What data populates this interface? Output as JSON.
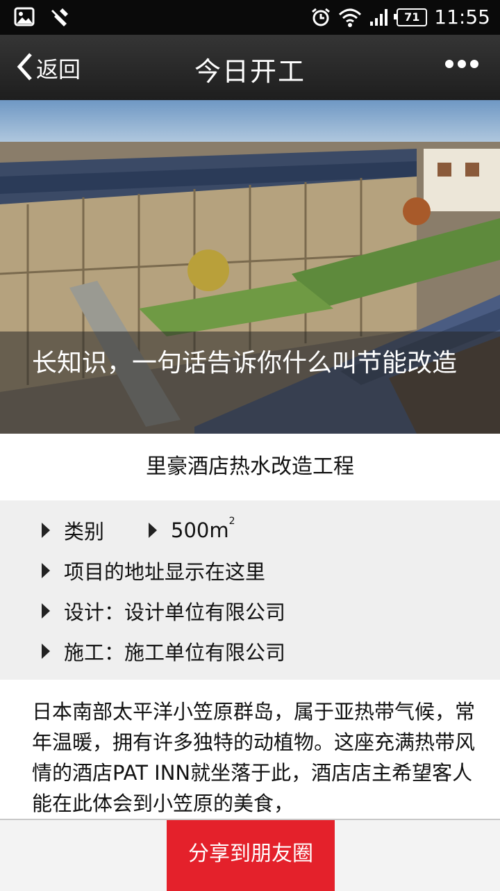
{
  "status_bar": {
    "battery": "71",
    "time": "11:55",
    "icons": [
      "image-icon",
      "wrench-icon",
      "alarm-icon",
      "wifi-icon",
      "signal-icon",
      "battery-icon"
    ]
  },
  "nav": {
    "back_label": "返回",
    "title": "今日开工",
    "more_icon": "more-dots-icon"
  },
  "hero": {
    "caption": "长知识，一句话告诉你什么叫节能改造"
  },
  "project": {
    "title": "里豪酒店热水改造工程",
    "category_label": "类别",
    "area": "500m",
    "area_superscript": "2",
    "address": "项目的地址显示在这里",
    "design": "设计：设计单位有限公司",
    "construction": "施工：施工单位有限公司"
  },
  "article": {
    "text": "日本南部太平洋小笠原群岛，属于亚热带气候，常年温暖，拥有许多独特的动植物。这座充满热带风情的酒店PAT INN就坐落于此，酒店店主希望客人能在此体会到小笠原的美食，"
  },
  "footer": {
    "share_label": "分享到朋友圈",
    "share_color": "#e4212b"
  }
}
